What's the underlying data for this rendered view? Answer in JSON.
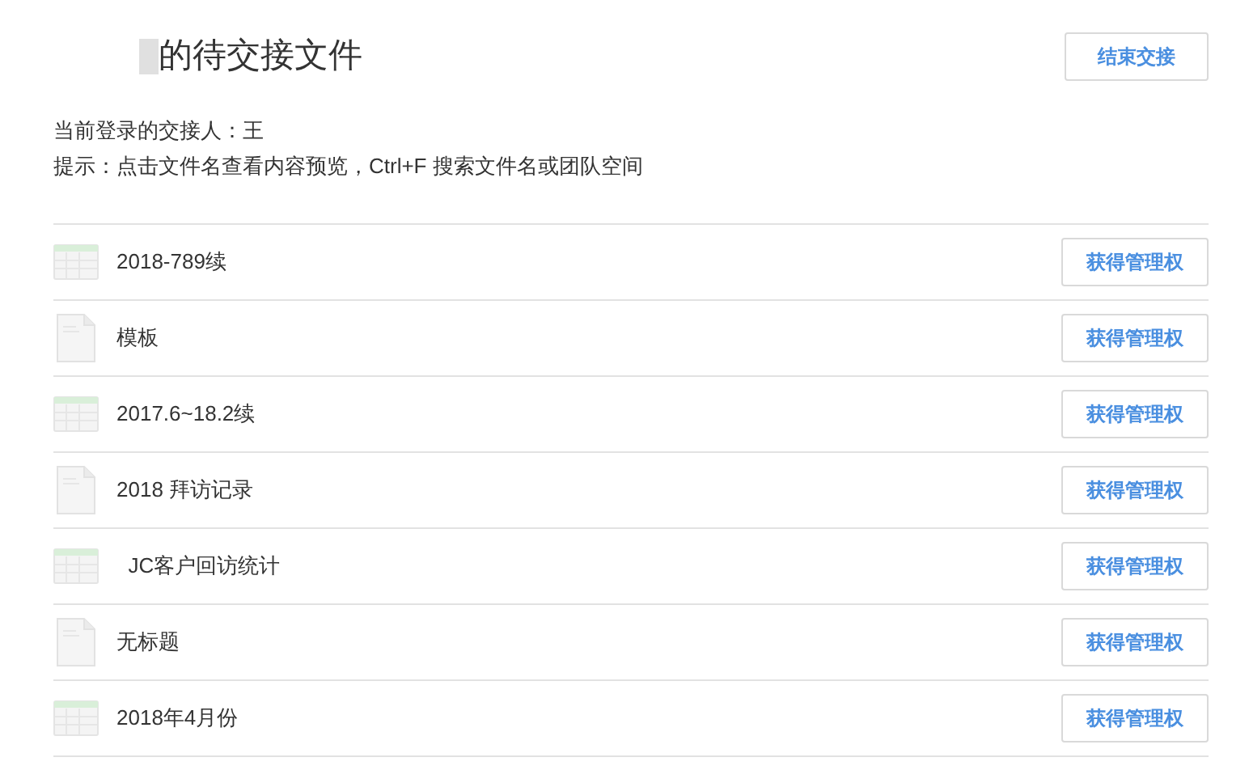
{
  "header": {
    "title": "的待交接文件",
    "button": "结束交接"
  },
  "info": {
    "current_user": "当前登录的交接人：王",
    "hint": "提示：点击文件名查看内容预览，Ctrl+F 搜索文件名或团队空间"
  },
  "files": [
    {
      "kind": "sheet",
      "name": "2018-789续",
      "action": "获得管理权"
    },
    {
      "kind": "doc",
      "name": "模板",
      "action": "获得管理权"
    },
    {
      "kind": "sheet",
      "name": "2017.6~18.2续",
      "action": "获得管理权"
    },
    {
      "kind": "doc",
      "name": "2018 拜访记录",
      "action": "获得管理权"
    },
    {
      "kind": "sheet",
      "name": "  JC客户回访统计",
      "action": "获得管理权"
    },
    {
      "kind": "doc",
      "name": "无标题",
      "action": "获得管理权"
    },
    {
      "kind": "sheet",
      "name": "2018年4月份",
      "action": "获得管理权"
    }
  ]
}
